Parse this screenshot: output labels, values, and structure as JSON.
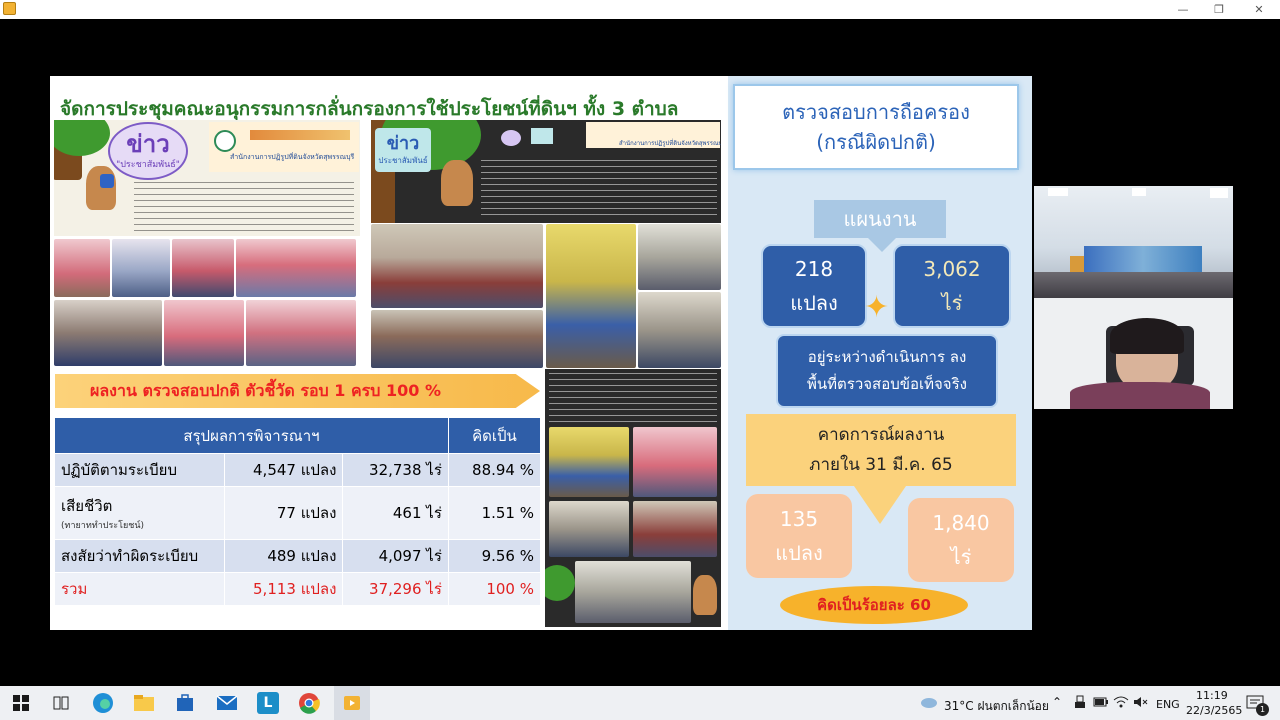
{
  "window": {
    "minimize": "—",
    "maximize": "❐",
    "close": "✕"
  },
  "slide": {
    "title": "จัดการประชุมคณะอนุกรรมการกลั่นกรองการใช้ประโยชน์ที่ดินฯ ทั้ง 3 ตำบล",
    "news_left": {
      "badge": "ข่าว",
      "badge_sub": "\"ประชาสัมพันธ์\"",
      "office": "สำนักงานการปฏิรูปที่ดินจังหวัดสุพรรณบุรี"
    },
    "news_right": {
      "badge": "ข่าว",
      "badge_sub": "ประชาสัมพันธ์",
      "office": "สำนักงานการปฏิรูปที่ดินจังหวัดสุพรรณบุรี"
    },
    "banner": "ผลงาน ตรวจสอบปกติ ตัวชี้วัด รอบ 1 ครบ 100 %",
    "table": {
      "header_summary": "สรุปผลการพิจารณาฯ",
      "header_percent": "คิดเป็น",
      "rows": [
        {
          "label": "ปฏิบัติตามระเบียบ",
          "note": "",
          "plots": "4,547 แปลง",
          "rai": "32,738 ไร่",
          "percent": "88.94 %"
        },
        {
          "label": "เสียชีวิต",
          "note": "(ทายาททำประโยชน์)",
          "plots": "77 แปลง",
          "rai": "461 ไร่",
          "percent": "1.51 %"
        },
        {
          "label": "สงสัยว่าทำผิดระเบียบ",
          "note": "",
          "plots": "489 แปลง",
          "rai": "4,097 ไร่",
          "percent": "9.56 %"
        }
      ],
      "total": {
        "label": "รวม",
        "plots": "5,113 แปลง",
        "rai": "37,296 ไร่",
        "percent": "100 %"
      }
    },
    "right": {
      "check_title_1": "ตรวจสอบการถือครอง",
      "check_title_2": "(กรณีผิดปกติ)",
      "plan": "แผนงาน",
      "plan_plots_num": "218",
      "plan_plots_unit": "แปลง",
      "plan_rai_num": "3,062",
      "plan_rai_unit": "ไร่",
      "progress_1": "อยู่ระหว่างดำเนินการ ลง",
      "progress_2": "พื้นที่ตรวจสอบข้อเท็จจริง",
      "forecast_1": "คาดการณ์ผลงาน",
      "forecast_2": "ภายใน 31 มี.ค. 65",
      "fc_plots_num": "135",
      "fc_plots_unit": "แปลง",
      "fc_rai_num": "1,840",
      "fc_rai_unit": "ไร่",
      "percent_label": "คิดเป็นร้อยละ 60"
    }
  },
  "taskbar": {
    "weather": "31°C ฝนตกเล็กน้อย",
    "language": "ENG",
    "time": "11:19",
    "date": "22/3/2565",
    "notification_count": "1"
  }
}
